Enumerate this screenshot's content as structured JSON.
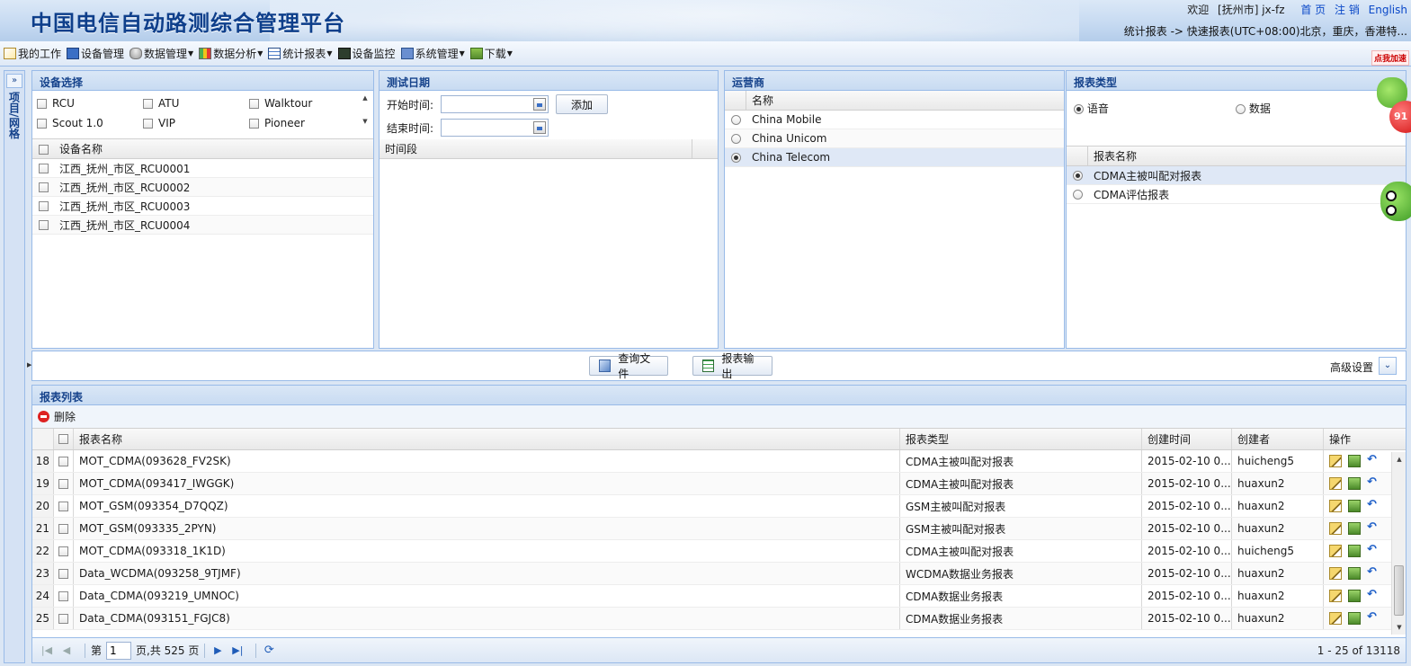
{
  "app": {
    "title": "中国电信自动路测综合管理平台",
    "welcome": "欢迎",
    "user": "[抚州市] jx-fz",
    "links": {
      "home": "首 页",
      "logout": "注 销",
      "lang": "English"
    },
    "breadcrumb": "统计报表 -> 快速报表(UTC+08:00)北京，重庆，香港特..."
  },
  "menu": [
    {
      "label": "我的工作",
      "icon": "document-icon",
      "dropdown": false
    },
    {
      "label": "设备管理",
      "icon": "monitor-icon",
      "dropdown": false
    },
    {
      "label": "数据管理",
      "icon": "database-icon",
      "dropdown": true
    },
    {
      "label": "数据分析",
      "icon": "chart-icon",
      "dropdown": true
    },
    {
      "label": "统计报表",
      "icon": "table-icon",
      "dropdown": true
    },
    {
      "label": "设备监控",
      "icon": "screen-icon",
      "dropdown": false
    },
    {
      "label": "系统管理",
      "icon": "system-icon",
      "dropdown": true
    },
    {
      "label": "下载",
      "icon": "download-icon",
      "dropdown": true
    }
  ],
  "sidebar": {
    "label": "项目/网格",
    "expand": "»"
  },
  "device_panel": {
    "title": "设备选择",
    "types": [
      "RCU",
      "ATU",
      "Walktour",
      "Scout 1.0",
      "VIP",
      "Pioneer"
    ],
    "column": "设备名称",
    "devices": [
      "江西_抚州_市区_RCU0001",
      "江西_抚州_市区_RCU0002",
      "江西_抚州_市区_RCU0003",
      "江西_抚州_市区_RCU0004"
    ]
  },
  "date_panel": {
    "title": "测试日期",
    "start_label": "开始时间:",
    "end_label": "结束时间:",
    "add_button": "添加",
    "column": "时间段"
  },
  "operator_panel": {
    "title": "运营商",
    "column": "名称",
    "operators": [
      {
        "name": "China Mobile",
        "selected": false
      },
      {
        "name": "China Unicom",
        "selected": false
      },
      {
        "name": "China Telecom",
        "selected": true
      }
    ]
  },
  "report_type_panel": {
    "title": "报表类型",
    "mode_voice": "语音",
    "mode_data": "数据",
    "column": "报表名称",
    "reports": [
      {
        "name": "CDMA主被叫配对报表",
        "selected": true
      },
      {
        "name": "CDMA评估报表",
        "selected": false
      }
    ]
  },
  "actions": {
    "query": "查询文件",
    "export": "报表输出",
    "advanced": "高级设置",
    "advanced_toggle": "⌄"
  },
  "report_list": {
    "title": "报表列表",
    "delete": "删除",
    "columns": [
      "报表名称",
      "报表类型",
      "创建时间",
      "创建者",
      "操作"
    ],
    "rows": [
      {
        "n": "18",
        "name": "MOT_CDMA(093628_FV2SK)",
        "type": "CDMA主被叫配对报表",
        "time": "2015-02-10 0...",
        "creator": "huicheng5"
      },
      {
        "n": "19",
        "name": "MOT_CDMA(093417_IWGGK)",
        "type": "CDMA主被叫配对报表",
        "time": "2015-02-10 0...",
        "creator": "huaxun2"
      },
      {
        "n": "20",
        "name": "MOT_GSM(093354_D7QQZ)",
        "type": "GSM主被叫配对报表",
        "time": "2015-02-10 0...",
        "creator": "huaxun2"
      },
      {
        "n": "21",
        "name": "MOT_GSM(093335_2PYN)",
        "type": "GSM主被叫配对报表",
        "time": "2015-02-10 0...",
        "creator": "huaxun2"
      },
      {
        "n": "22",
        "name": "MOT_CDMA(093318_1K1D)",
        "type": "CDMA主被叫配对报表",
        "time": "2015-02-10 0...",
        "creator": "huicheng5"
      },
      {
        "n": "23",
        "name": "Data_WCDMA(093258_9TJMF)",
        "type": "WCDMA数据业务报表",
        "time": "2015-02-10 0...",
        "creator": "huaxun2"
      },
      {
        "n": "24",
        "name": "Data_CDMA(093219_UMNOC)",
        "type": "CDMA数据业务报表",
        "time": "2015-02-10 0...",
        "creator": "huaxun2"
      },
      {
        "n": "25",
        "name": "Data_CDMA(093151_FGJC8)",
        "type": "CDMA数据业务报表",
        "time": "2015-02-10 0...",
        "creator": "huaxun2"
      }
    ]
  },
  "pager": {
    "page_prefix": "第",
    "page": "1",
    "page_suffix": "页,共 525 页",
    "info": "1 - 25 of 13118"
  },
  "promo": {
    "tag": "点我加速",
    "percent": "91"
  }
}
